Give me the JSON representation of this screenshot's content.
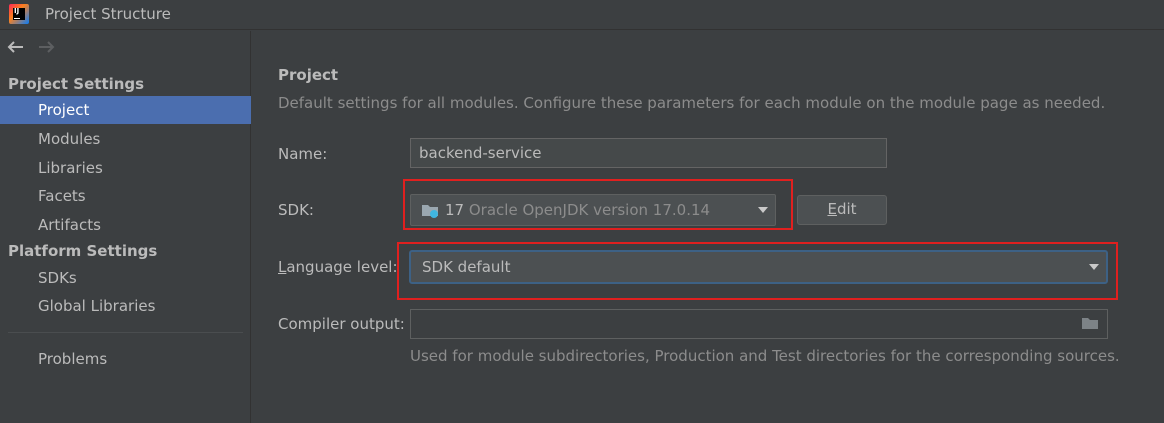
{
  "window": {
    "title": "Project Structure",
    "logo_text": "IJ"
  },
  "sidebar": {
    "project_settings_header": "Project Settings",
    "project_settings_items": [
      {
        "label": "Project",
        "selected": true
      },
      {
        "label": "Modules"
      },
      {
        "label": "Libraries"
      },
      {
        "label": "Facets"
      },
      {
        "label": "Artifacts"
      }
    ],
    "platform_settings_header": "Platform Settings",
    "platform_settings_items": [
      {
        "label": "SDKs"
      },
      {
        "label": "Global Libraries"
      }
    ],
    "problems_label": "Problems"
  },
  "main": {
    "title": "Project",
    "description": "Default settings for all modules. Configure these parameters for each module on the module page as needed.",
    "name_label": "Name:",
    "name_value": "backend-service",
    "sdk_label": "SDK:",
    "sdk_version": "17",
    "sdk_name": "Oracle OpenJDK version 17.0.14",
    "edit_button_first": "E",
    "edit_button_rest": "dit",
    "language_level_label_first": "L",
    "language_level_label_rest": "anguage level:",
    "language_level_value": "SDK default",
    "compiler_output_label": "Compiler output:",
    "compiler_output_value": "",
    "compiler_hint": "Used for module subdirectories, Production and Test directories for the corresponding sources."
  },
  "colors": {
    "background": "#3c3f41",
    "selection": "#4b6eaf",
    "highlight_box": "#e0201f",
    "focus_border": "#3d6185"
  }
}
